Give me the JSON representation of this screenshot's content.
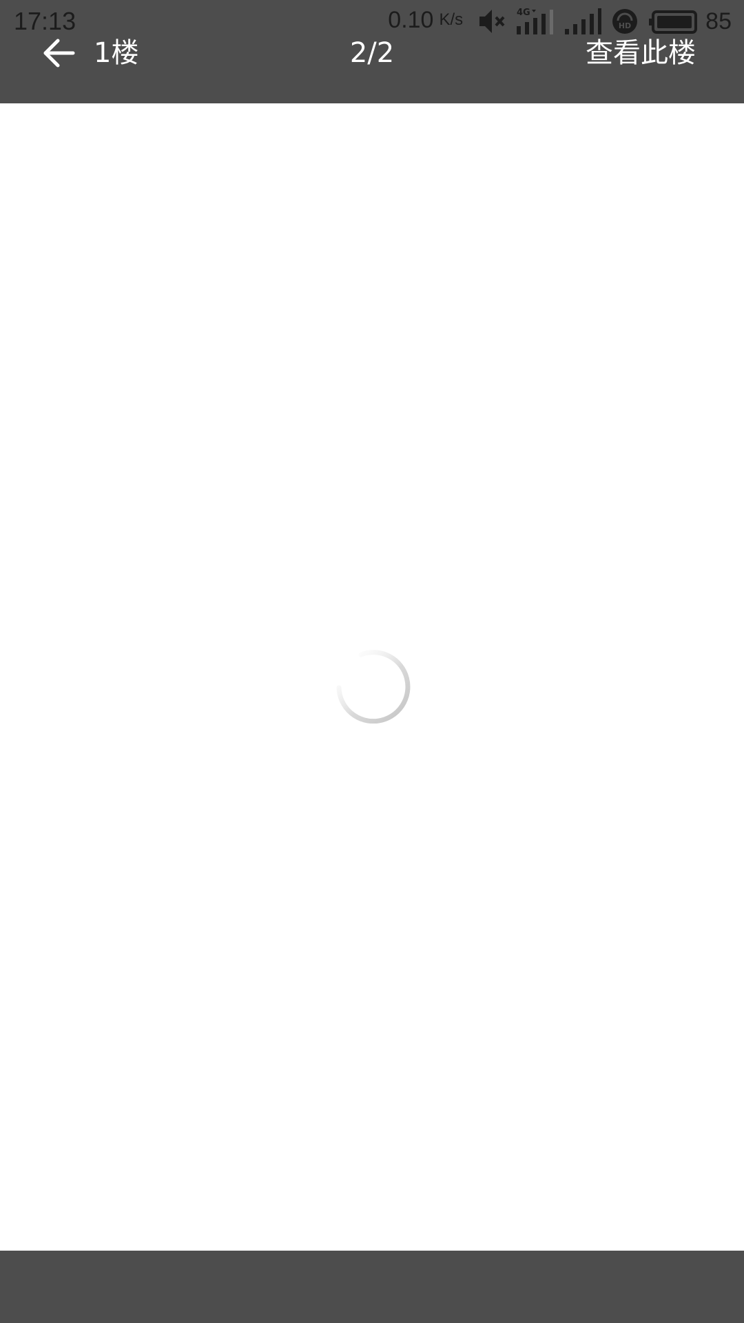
{
  "status_bar": {
    "time": "17:13",
    "net_speed": "0.10",
    "net_speed_unit": "K/s",
    "battery_level": "85",
    "icons": [
      "mute-icon",
      "4g-signal-icon",
      "signal-icon",
      "hd-call-icon",
      "battery-icon"
    ]
  },
  "header": {
    "back_icon": "arrow-left-icon",
    "floor_label": "1楼",
    "page_counter": "2/2",
    "view_floor_button": "查看此楼"
  },
  "content": {
    "loading_indicator": "spinner-icon"
  },
  "colors": {
    "bar_background": "#4d4d4d",
    "content_background": "#ffffff",
    "header_text": "#ffffff",
    "status_text": "#1c1c1c",
    "spinner": "#c8c8c8"
  }
}
